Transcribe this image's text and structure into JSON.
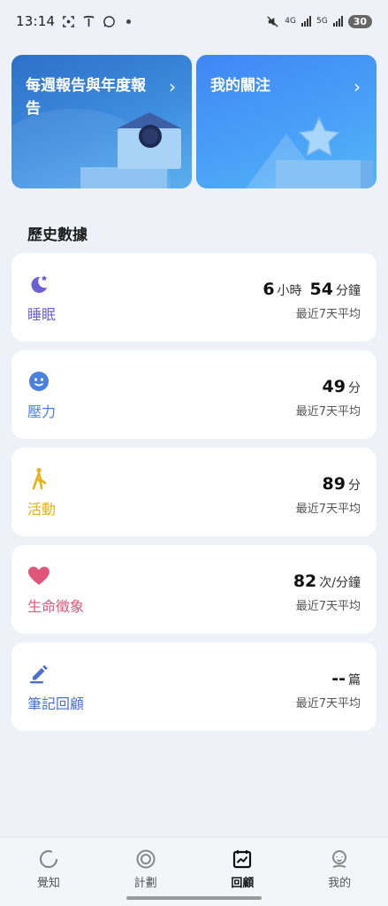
{
  "status_bar": {
    "time": "13:14",
    "network_4g": "4G",
    "network_5g": "5G",
    "battery": "30"
  },
  "top_cards": [
    {
      "title": "每週報告與年度報告",
      "icon": "envelope-ring-illustration"
    },
    {
      "title": "我的關注",
      "icon": "star-pedestal-illustration"
    }
  ],
  "section_title": "歷史數據",
  "metrics": [
    {
      "label": "睡眠",
      "color": "#6b5fd6",
      "icon": "moon-icon",
      "value_parts": [
        {
          "num": "6",
          "unit": "小時"
        },
        {
          "num": "54",
          "unit": "分鐘"
        }
      ],
      "sub": "最近7天平均"
    },
    {
      "label": "壓力",
      "color": "#4b7fe0",
      "icon": "smiley-icon",
      "value_parts": [
        {
          "num": "49",
          "unit": "分"
        }
      ],
      "sub": "最近7天平均"
    },
    {
      "label": "活動",
      "color": "#e8b11a",
      "icon": "walking-icon",
      "value_parts": [
        {
          "num": "89",
          "unit": "分"
        }
      ],
      "sub": "最近7天平均"
    },
    {
      "label": "生命徵象",
      "color": "#e0557a",
      "icon": "heart-icon",
      "value_parts": [
        {
          "num": "82",
          "unit": "次/分鐘"
        }
      ],
      "sub": "最近7天平均"
    },
    {
      "label": "筆記回顧",
      "color": "#4b6fd0",
      "icon": "pen-icon",
      "value_parts": [
        {
          "num": "--",
          "unit": "篇"
        }
      ],
      "sub": "最近7天平均"
    }
  ],
  "bottom_nav": [
    {
      "label": "覺知",
      "icon": "awareness-ring-icon",
      "active": false
    },
    {
      "label": "計劃",
      "icon": "plan-ring-icon",
      "active": false
    },
    {
      "label": "回顧",
      "icon": "review-chart-icon",
      "active": true
    },
    {
      "label": "我的",
      "icon": "profile-icon",
      "active": false
    }
  ]
}
